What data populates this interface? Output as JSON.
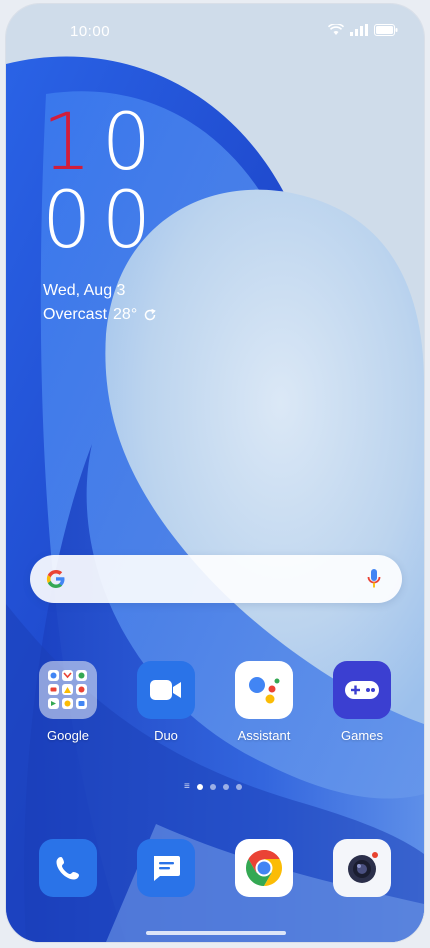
{
  "status_bar": {
    "time": "10:00",
    "icons": [
      "wifi-icon",
      "signal-icon",
      "battery-icon"
    ]
  },
  "clock": {
    "hour_first_digit": "1",
    "hour_second_digit": "0",
    "minutes": "00"
  },
  "date": "Wed, Aug 3",
  "weather": {
    "condition": "Overcast",
    "temperature": "28°",
    "icon": "refresh-icon"
  },
  "search": {
    "icon": "google-g-icon",
    "mic_icon": "mic-icon"
  },
  "apps": [
    {
      "label": "Google",
      "icon": "google-folder-icon"
    },
    {
      "label": "Duo",
      "icon": "duo-video-icon"
    },
    {
      "label": "Assistant",
      "icon": "assistant-icon"
    },
    {
      "label": "Games",
      "icon": "gamepad-icon"
    }
  ],
  "pager": {
    "pages": 4,
    "active": 1
  },
  "dock": [
    {
      "label": "",
      "icon": "phone-icon"
    },
    {
      "label": "",
      "icon": "messages-icon"
    },
    {
      "label": "",
      "icon": "chrome-icon"
    },
    {
      "label": "",
      "icon": "camera-icon"
    }
  ],
  "colors": {
    "accent_red": "#d21d3b",
    "wallpaper_blue": "#1f4fd6"
  }
}
